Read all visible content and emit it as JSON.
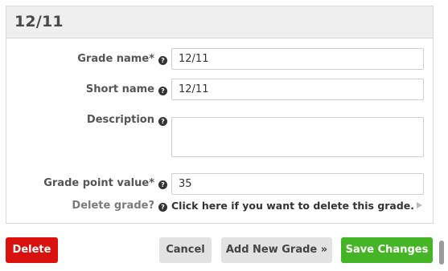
{
  "panel": {
    "title": "12/11"
  },
  "form": {
    "grade_name": {
      "label": "Grade name",
      "required_mark": "*",
      "value": "12/11"
    },
    "short_name": {
      "label": "Short name",
      "value": "12/11"
    },
    "description": {
      "label": "Description",
      "value": ""
    },
    "grade_point_value": {
      "label": "Grade point value",
      "required_mark": "*",
      "value": "35"
    },
    "delete_grade": {
      "label": "Delete grade?",
      "link_text": "Click here if you want to delete this grade."
    }
  },
  "icons": {
    "help": "help-circle-icon",
    "help_glyph": "?",
    "expand": "play-arrow-icon"
  },
  "buttons": {
    "delete": "Delete",
    "cancel": "Cancel",
    "add_new": "Add New Grade »",
    "save": "Save Changes"
  },
  "colors": {
    "delete_button": "#d9110f",
    "save_button": "#45b526",
    "neutral_button": "#e2e2e2",
    "header_background": "#efefef"
  }
}
